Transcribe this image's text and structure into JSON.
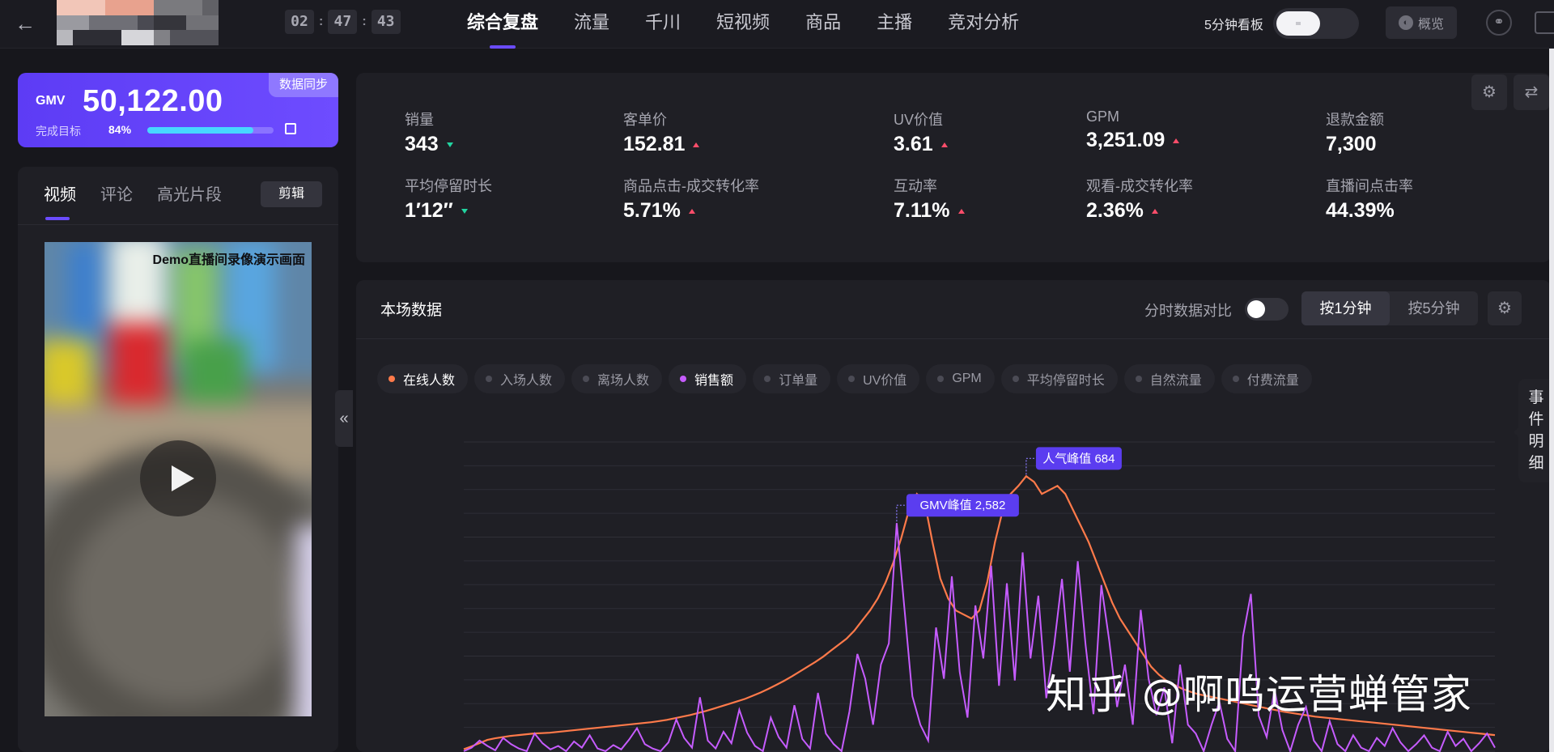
{
  "topbar": {
    "timer": [
      "02",
      "47",
      "43"
    ],
    "nav": [
      "综合复盘",
      "流量",
      "千川",
      "短视频",
      "商品",
      "主播",
      "竞对分析"
    ],
    "active_nav": 0,
    "board_label": "5分钟看板",
    "overview_label": "概览",
    "icons": [
      "back-arrow-icon",
      "headset-icon",
      "fullscreen-icon"
    ]
  },
  "gmv": {
    "label": "GMV",
    "value": "50,122.00",
    "sync_label": "数据同步",
    "target_label": "完成目标",
    "target_pct_text": "84%",
    "target_fraction": 0.84
  },
  "media": {
    "tabs": [
      "视频",
      "评论",
      "高光片段"
    ],
    "edit_label": "剪辑",
    "video_caption": "Demo直播间录像演示画面"
  },
  "metrics": [
    {
      "label": "销量",
      "value": "343",
      "trend": "down"
    },
    {
      "label": "客单价",
      "value": "152.81",
      "trend": "up"
    },
    {
      "label": "UV价值",
      "value": "3.61",
      "trend": "up"
    },
    {
      "label": "GPM",
      "value": "3,251.09",
      "trend": "up"
    },
    {
      "label": "退款金额",
      "value": "7,300",
      "trend": ""
    },
    {
      "label": "平均停留时长",
      "value": "1′12′′",
      "trend": "down"
    },
    {
      "label": "商品点击-成交转化率",
      "value": "5.71%",
      "trend": "up"
    },
    {
      "label": "互动率",
      "value": "7.11%",
      "trend": "up"
    },
    {
      "label": "观看-成交转化率",
      "value": "2.36%",
      "trend": "up"
    },
    {
      "label": "直播间点击率",
      "value": "44.39%",
      "trend": ""
    }
  ],
  "colors": {
    "accent": "#6b4cff",
    "up": "#ff4d6a",
    "down": "#22d3a0",
    "online_series": "#ff7a4a",
    "sales_series": "#c65cff"
  },
  "panel": {
    "title": "本场数据",
    "compare_label": "分时数据对比",
    "granularity": [
      "按1分钟",
      "按5分钟"
    ],
    "active_granularity": 0
  },
  "legend": [
    {
      "name": "在线人数",
      "on": true,
      "color": "#ff7a4a"
    },
    {
      "name": "入场人数",
      "on": false,
      "color": ""
    },
    {
      "name": "离场人数",
      "on": false,
      "color": ""
    },
    {
      "name": "销售额",
      "on": true,
      "color": "#c65cff"
    },
    {
      "name": "订单量",
      "on": false,
      "color": ""
    },
    {
      "name": "UV价值",
      "on": false,
      "color": ""
    },
    {
      "name": "GPM",
      "on": false,
      "color": ""
    },
    {
      "name": "平均停留时长",
      "on": false,
      "color": ""
    },
    {
      "name": "自然流量",
      "on": false,
      "color": ""
    },
    {
      "name": "付费流量",
      "on": false,
      "color": ""
    }
  ],
  "event_tab": "事件明细",
  "watermark": "知乎 @啊呜运营蝉管家",
  "chart_data": {
    "type": "line",
    "grid": true,
    "series": [
      {
        "name": "在线人数",
        "values": [
          5,
          12,
          20,
          28,
          32,
          35,
          38,
          40,
          42,
          44,
          45,
          46,
          48,
          50,
          52,
          54,
          56,
          58,
          60,
          62,
          64,
          66,
          68,
          70,
          72,
          75,
          78,
          82,
          86,
          90,
          95,
          100,
          106,
          112,
          118,
          124,
          130,
          138,
          146,
          155,
          165,
          175,
          186,
          198,
          210,
          222,
          235,
          250,
          265,
          280,
          300,
          325,
          350,
          380,
          420,
          470,
          530,
          600,
          640,
          620,
          520,
          430,
          380,
          350,
          340,
          330,
          350,
          420,
          520,
          600,
          640,
          660,
          684,
          670,
          640,
          650,
          660,
          640,
          600,
          560,
          520,
          470,
          420,
          370,
          330,
          300,
          270,
          240,
          210,
          190,
          175,
          165,
          155,
          148,
          142,
          138,
          134,
          130,
          126,
          122,
          118,
          114,
          110,
          106,
          102,
          98,
          95,
          92,
          89,
          86,
          84,
          82,
          80,
          78,
          76,
          74,
          72,
          70,
          68,
          66,
          64,
          62,
          60,
          58,
          56,
          54,
          52,
          50,
          48,
          46,
          44,
          42,
          40
        ]
      },
      {
        "name": "销售额",
        "values": [
          0,
          40,
          120,
          60,
          10,
          150,
          80,
          30,
          0,
          200,
          90,
          20,
          60,
          0,
          110,
          40,
          180,
          30,
          0,
          70,
          20,
          130,
          260,
          80,
          30,
          0,
          100,
          360,
          150,
          40,
          610,
          120,
          30,
          220,
          90,
          470,
          210,
          60,
          0,
          380,
          160,
          40,
          520,
          140,
          30,
          660,
          200,
          80,
          0,
          450,
          1100,
          820,
          300,
          980,
          1220,
          2582,
          1600,
          620,
          300,
          120,
          1400,
          820,
          1980,
          900,
          380,
          1650,
          1050,
          2100,
          740,
          1900,
          800,
          2250,
          1050,
          1760,
          600,
          1200,
          1950,
          900,
          2150,
          1200,
          420,
          1880,
          1250,
          500,
          980,
          300,
          1600,
          820,
          410,
          720,
          90,
          980,
          300,
          200,
          0,
          300,
          560,
          140,
          0,
          1300,
          1780,
          400,
          160,
          700,
          240,
          0,
          300,
          500,
          120,
          0,
          340,
          80,
          0,
          180,
          40,
          0,
          150,
          60,
          260,
          100,
          0,
          80,
          180,
          40,
          0,
          220,
          60,
          140,
          0,
          90,
          200,
          40
        ]
      }
    ],
    "ylim": [
      0,
      3500
    ],
    "annotations": [
      {
        "label": "人气峰值 684",
        "series": "在线人数",
        "index": 72
      },
      {
        "label": "GMV峰值 2,582",
        "series": "销售额",
        "index": 55
      }
    ]
  }
}
